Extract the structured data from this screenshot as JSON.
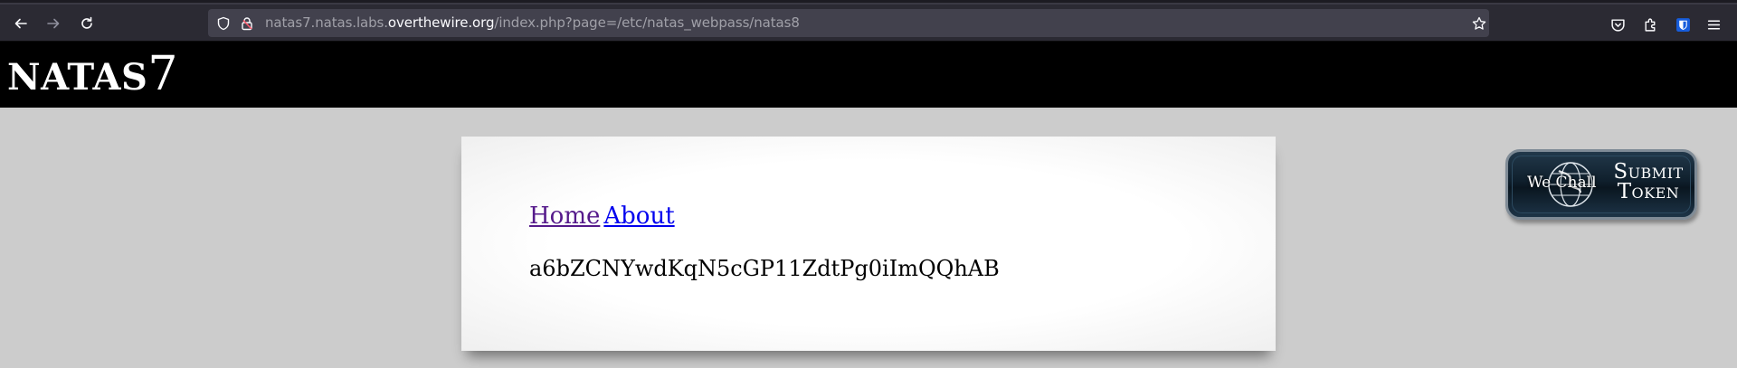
{
  "browser": {
    "url_prefix": "natas7.natas.labs.",
    "url_host": "overthewire.org",
    "url_path": "/index.php?page=/etc/natas_webpass/natas8",
    "icons": [
      "back-icon",
      "forward-icon",
      "reload-icon",
      "shield-icon",
      "lock-icon",
      "star-icon",
      "pocket-icon",
      "extensions-icon",
      "bitwarden-icon",
      "menu-icon"
    ]
  },
  "site": {
    "title_word": "NATAS",
    "title_number": "7"
  },
  "content": {
    "link_home": "Home",
    "link_about": "About",
    "secret": "a6bZCNYwdKqN5cGP11ZdtPg0iImQQhAB"
  },
  "wechall": {
    "brand": "We Chall",
    "line1": "Submit",
    "line2": "Token"
  },
  "colors": {
    "page_bg": "#cccccc",
    "header_bg": "#000000",
    "visited_link": "#551a8b",
    "link": "#0000ee"
  }
}
